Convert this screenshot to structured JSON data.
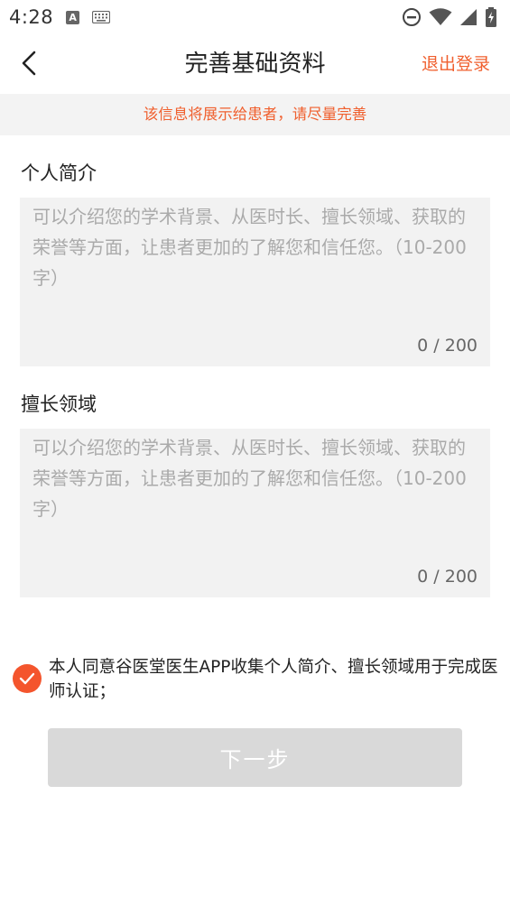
{
  "status_bar": {
    "time": "4:28",
    "a_badge": "A"
  },
  "header": {
    "title": "完善基础资料",
    "logout": "退出登录"
  },
  "notice": "该信息将展示给患者，请尽量完善",
  "intro": {
    "label": "个人简介",
    "placeholder": "可以介绍您的学术背景、从医时长、擅长领域、获取的荣誉等方面，让患者更加的了解您和信任您。（10-200字）",
    "counter": "0 / 200"
  },
  "expertise": {
    "label": "擅长领域",
    "placeholder": "可以介绍您的学术背景、从医时长、擅长领域、获取的荣誉等方面，让患者更加的了解您和信任您。（10-200字）",
    "counter": "0 / 200"
  },
  "agreement": {
    "checked": true,
    "text": "本人同意谷医堂医生APP收集个人简介、擅长领域用于完成医师认证；"
  },
  "next_button": "下一步",
  "colors": {
    "accent": "#f0602f",
    "button_disabled": "#d9d9d9",
    "notice_bg": "#f3f3f3"
  }
}
